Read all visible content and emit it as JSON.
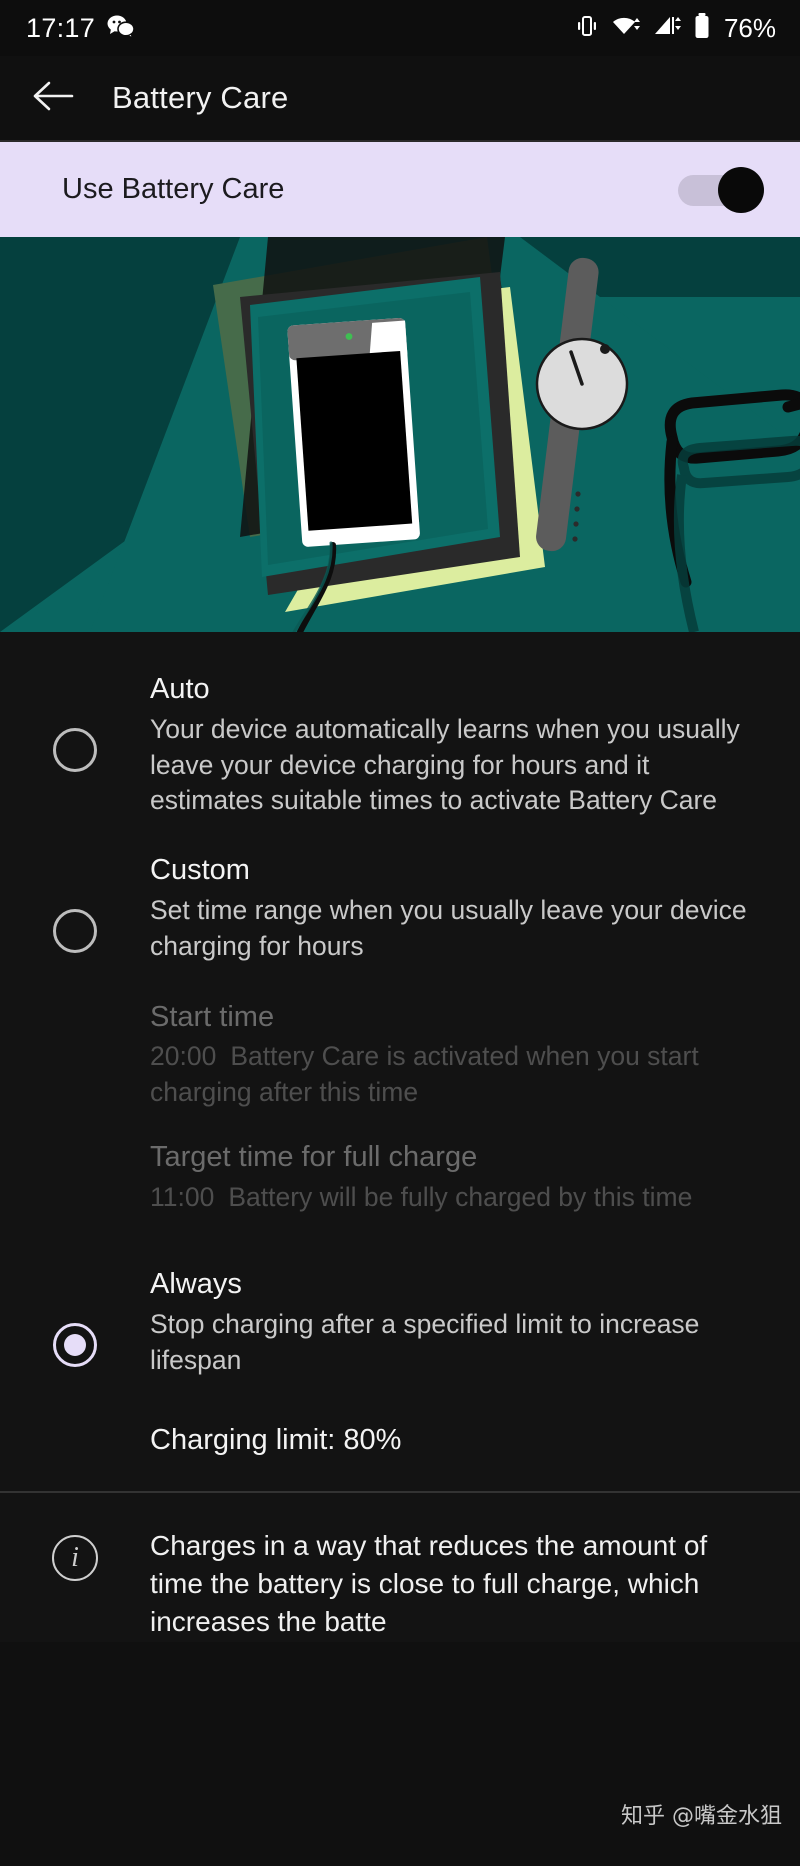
{
  "statusbar": {
    "time": "17:17",
    "icons": [
      "wechat-icon",
      "vibrate-icon",
      "wifi-icon",
      "signal-icon",
      "battery-icon"
    ],
    "battery_percent": "76%"
  },
  "appbar": {
    "back_icon": "back-arrow-icon",
    "title": "Battery Care"
  },
  "master_switch": {
    "label": "Use Battery Care",
    "state": "on",
    "track_color": "#c8c0d8",
    "thumb_color": "#090909",
    "bar_color": "#e6ddf8"
  },
  "hero": {
    "name": "battery-care-illustration",
    "alt": "Phone charging on a desk next to a watch and glasses",
    "colors": {
      "bg_dark": "#05403e",
      "bg_light": "#0a6661",
      "paper_green": "#466b4a",
      "paper_lime": "#dced9f",
      "paper_dark": "#2b2b2b",
      "phone_white": "#ffffff",
      "phone_screen": "#000000",
      "led_green": "#3fbf52",
      "watch_strap": "#5c5c5c",
      "watch_face": "#dcdcdc"
    }
  },
  "options": [
    {
      "id": "auto",
      "title": "Auto",
      "desc": "Your device automatically learns when you usually leave your device charging for hours and it estimates suitable times to activate Battery Care",
      "selected": false
    },
    {
      "id": "custom",
      "title": "Custom",
      "desc": "Set time range when you usually leave your device charging for hours",
      "selected": false
    },
    {
      "id": "always",
      "title": "Always",
      "desc": "Stop charging after a specified limit to increase lifespan",
      "selected": true
    }
  ],
  "sub_settings": [
    {
      "id": "start-time",
      "title": "Start time",
      "value": "20:00",
      "desc": "Battery Care is activated when you start charging after this time",
      "enabled": false
    },
    {
      "id": "target-time",
      "title": "Target time for full charge",
      "value": "11:00",
      "desc": "Battery will be fully charged by this time",
      "enabled": false
    }
  ],
  "charging_limit": {
    "label": "Charging limit: 80%"
  },
  "footer": {
    "icon": "info-icon",
    "text": "Charges in a way that reduces the amount of time the battery is close to full charge, which increases the batte"
  },
  "watermark": {
    "text": "知乎 @嘴金水狙"
  }
}
